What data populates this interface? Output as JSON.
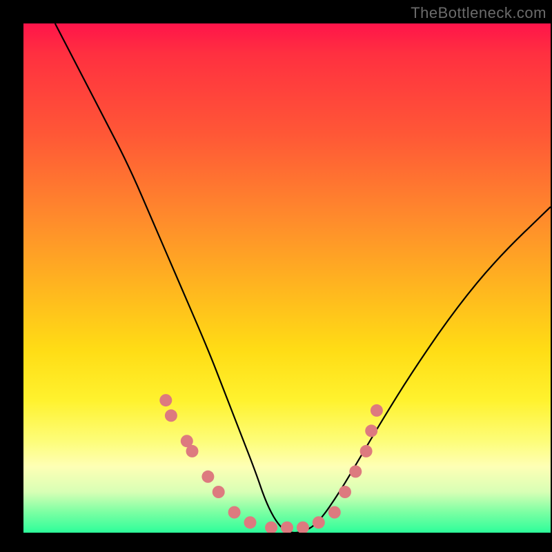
{
  "watermark": "TheBottleneck.com",
  "chart_data": {
    "type": "line",
    "title": "",
    "xlabel": "",
    "ylabel": "",
    "xlim": [
      0,
      100
    ],
    "ylim": [
      0,
      100
    ],
    "series": [
      {
        "name": "curve",
        "x": [
          6,
          10,
          15,
          20,
          25,
          30,
          35,
          38,
          41,
          44,
          46,
          48,
          50,
          53,
          56,
          60,
          64,
          68,
          74,
          82,
          90,
          100
        ],
        "y": [
          100,
          92,
          82,
          72,
          60,
          48,
          36,
          28,
          20,
          12,
          6,
          2,
          0,
          0,
          2,
          8,
          15,
          22,
          32,
          44,
          54,
          64
        ]
      }
    ],
    "markers": [
      {
        "x": 27,
        "y": 26
      },
      {
        "x": 28,
        "y": 23
      },
      {
        "x": 31,
        "y": 18
      },
      {
        "x": 32,
        "y": 16
      },
      {
        "x": 35,
        "y": 11
      },
      {
        "x": 37,
        "y": 8
      },
      {
        "x": 40,
        "y": 4
      },
      {
        "x": 43,
        "y": 2
      },
      {
        "x": 47,
        "y": 1
      },
      {
        "x": 50,
        "y": 1
      },
      {
        "x": 53,
        "y": 1
      },
      {
        "x": 56,
        "y": 2
      },
      {
        "x": 59,
        "y": 4
      },
      {
        "x": 61,
        "y": 8
      },
      {
        "x": 63,
        "y": 12
      },
      {
        "x": 65,
        "y": 16
      },
      {
        "x": 66,
        "y": 20
      },
      {
        "x": 67,
        "y": 24
      }
    ],
    "marker_color": "#dd7a7f",
    "marker_radius": 9,
    "curve_color": "#000000",
    "curve_width": 2.2
  }
}
